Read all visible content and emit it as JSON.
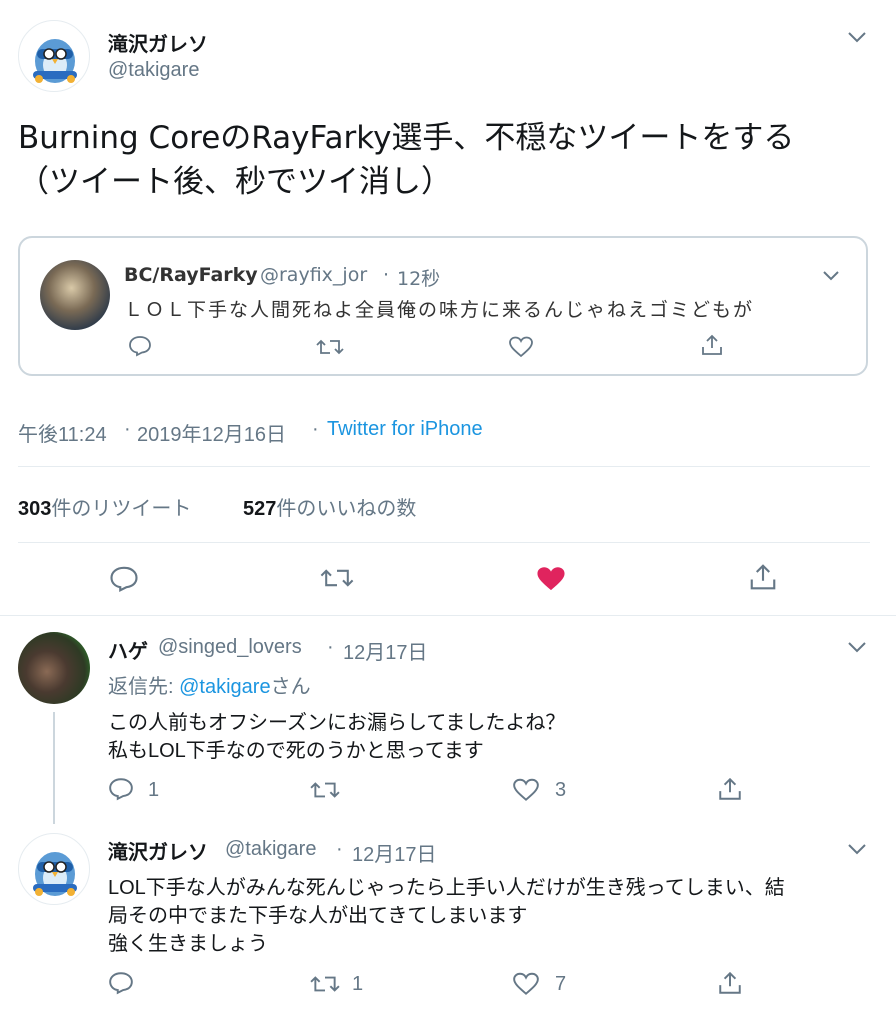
{
  "main_tweet": {
    "display_name": "滝沢ガレソ",
    "handle": "@takigare",
    "text_line1": "Burning CoreのRayFarky選手、不穏なツイートをする",
    "text_line2": "（ツイート後、秒でツイ消し）",
    "time": "午後11:24",
    "date": "2019年12月16日",
    "sep": "·",
    "source": "Twitter for iPhone",
    "retweet_count": "303",
    "retweet_label": "件のリツイート",
    "like_count": "527",
    "like_label": "件のいいねの数"
  },
  "quoted_tweet": {
    "display_name": "BC/RayFarky",
    "handle": "@rayfix_jor",
    "sep": "·",
    "time": "12秒",
    "text": "ＬＯＬ下手な人間死ねよ全員俺の味方に来るんじゃねえゴミどもが"
  },
  "reply1": {
    "display_name": "ハゲ",
    "handle": "@singed_lovers",
    "sep": "·",
    "date": "12月17日",
    "reply_to_prefix": "返信先: ",
    "reply_to_handle": "@takigare",
    "reply_to_suffix": "さん",
    "text_line1": "この人前もオフシーズンにお漏らしてましたよね？",
    "text_line2": "私もLOL下手なので死のうかと思ってます",
    "reply_count": "1",
    "retweet_count": "",
    "like_count": "3"
  },
  "reply2": {
    "display_name": "滝沢ガレソ",
    "handle": "@takigare",
    "sep": "·",
    "date": "12月17日",
    "text_line1": "LOL下手な人がみんな死んじゃったら上手い人だけが生き残ってしまい、結",
    "text_line2": "局その中でまた下手な人が出てきてしまいます",
    "text_line3": "強く生きましょう",
    "reply_count": "",
    "retweet_count": "1",
    "like_count": "7"
  },
  "colors": {
    "accent": "#1b95e0",
    "like_active": "#e0245e",
    "icon_gray": "#657786",
    "border": "#e6ecf0"
  },
  "icons": [
    "chevron-down-icon",
    "reply-icon",
    "retweet-icon",
    "like-icon",
    "share-icon"
  ]
}
